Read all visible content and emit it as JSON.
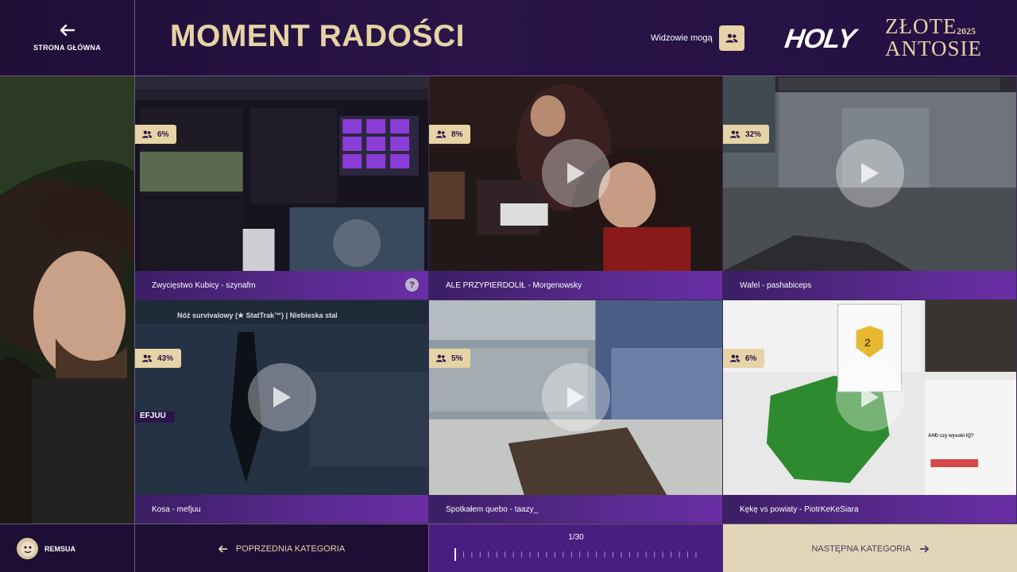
{
  "header": {
    "home_label": "STRONA GŁÓWNA",
    "title": "MOMENT RADOŚCI",
    "viewers_label": "Widzowie mogą",
    "logo_brand": "HOLY",
    "logo_line1": "ZŁOTE",
    "logo_line2": "ANTOSIE",
    "logo_year": "2025"
  },
  "tiles": [
    {
      "caption": "Zwycięstwo Kubicy - szynafm",
      "percent": "6%",
      "help": "?"
    },
    {
      "caption": "ALE PRZYPIERDOLIŁ - Morgenowsky",
      "percent": "8%"
    },
    {
      "caption": "Wafel - pashabiceps",
      "percent": "32%"
    },
    {
      "caption": "Kosa - mefjuu",
      "percent": "43%",
      "overlay": "Nóż survivalowy (★ StatTrak™) | Niebieska stal",
      "overlay2": "EFJUU"
    },
    {
      "caption": "Spotkałem quebo - taazy_",
      "percent": "5%"
    },
    {
      "caption": "Kękę vs powiaty - PiotrKeKeSiara",
      "percent": "6%",
      "overlay": "AHD czy wysoki IQ?",
      "overlay2": "2"
    }
  ],
  "footer": {
    "username": "REMSUA",
    "prev_label": "POPRZEDNIA KATEGORIA",
    "progress_text": "1/30",
    "progress_current": 1,
    "progress_total": 30,
    "next_label": "NASTĘPNA KATEGORIA"
  },
  "colors": {
    "accent_gold": "#e6d3a6",
    "purple_dark": "#1e0e36",
    "purple_mid": "#4a1d80",
    "caption_purple": "#5a2a90"
  },
  "icons": {
    "home": "arrow-left-icon",
    "viewers": "users-icon",
    "play": "play-icon",
    "badge": "users-icon"
  }
}
